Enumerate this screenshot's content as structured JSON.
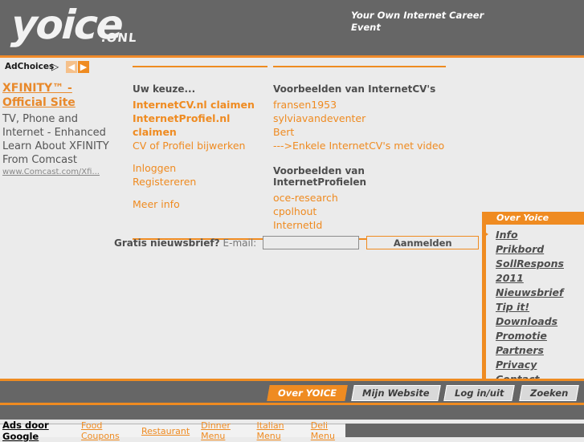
{
  "header": {
    "logo_text": "yoice",
    "logo_suffix": ".ONL",
    "tagline": "Your Own Internet Career Event"
  },
  "ad_left": {
    "adchoices_label": "AdChoices",
    "adchoices_icon": "adchoices-triangle-icon",
    "prev_arrow": "◀",
    "next_arrow": "▶",
    "title": "XFINITY™ - Official Site",
    "body": "TV, Phone and Internet - Enhanced Learn About XFINITY From Comcast",
    "url": "www.Comcast.com/Xfi..."
  },
  "main": {
    "left_column": {
      "heading": "Uw keuze...",
      "links_primary": [
        {
          "label": "InternetCV.nl claimen",
          "bold": true
        },
        {
          "label": "InternetProfiel.nl claimen",
          "bold": true
        },
        {
          "label": "CV of Profiel bijwerken",
          "bold": false
        }
      ],
      "links_secondary": [
        {
          "label": "Inloggen",
          "bold": false
        },
        {
          "label": "Registereren",
          "bold": false
        }
      ],
      "links_tertiary": [
        {
          "label": "Meer info",
          "bold": false
        }
      ]
    },
    "right_column": {
      "heading_cv": "Voorbeelden van InternetCV's",
      "links_cv": [
        {
          "label": "fransen1953"
        },
        {
          "label": "sylviavandeventer"
        },
        {
          "label": "Bert"
        },
        {
          "label": "--->Enkele InternetCV's met video"
        }
      ],
      "heading_profiel": "Voorbeelden van InternetProfielen",
      "links_profiel": [
        {
          "label": "oce-research"
        },
        {
          "label": "cpolhout"
        },
        {
          "label": "InternetId"
        }
      ]
    }
  },
  "newsletter": {
    "label_bold": "Gratis nieuwsbrief?",
    "label": "E-mail:",
    "input_value": "",
    "input_placeholder": "",
    "submit_label": "Aanmelden"
  },
  "sidebar": {
    "title": "Over Yoice",
    "marker": "active-arrow-icon",
    "items": [
      {
        "label": "Info"
      },
      {
        "label": "Prikbord"
      },
      {
        "label": "SollRespons 2011"
      },
      {
        "label": "Nieuwsbrief"
      },
      {
        "label": "Tip it!"
      },
      {
        "label": "Downloads"
      },
      {
        "label": "Promotie"
      },
      {
        "label": "Partners"
      },
      {
        "label": "Privacy"
      },
      {
        "label": "Contact"
      }
    ]
  },
  "footer": {
    "tabs": [
      {
        "label": "Over YOICE",
        "active": true
      },
      {
        "label": "Mijn Website",
        "active": false
      },
      {
        "label": "Log in/uit",
        "active": false
      },
      {
        "label": "Zoeken",
        "active": false
      }
    ]
  },
  "ads_bar": {
    "label": "Ads door Google",
    "links": [
      {
        "label": "Food Coupons"
      },
      {
        "label": "Restaurant"
      },
      {
        "label": "Dinner Menu"
      },
      {
        "label": "Italian Menu"
      },
      {
        "label": "Deli Menu"
      }
    ]
  },
  "colors": {
    "orange": "#ef8b21",
    "dark_gray": "#666666",
    "page_bg": "#ebebeb",
    "text_gray": "#4d4d4d"
  }
}
